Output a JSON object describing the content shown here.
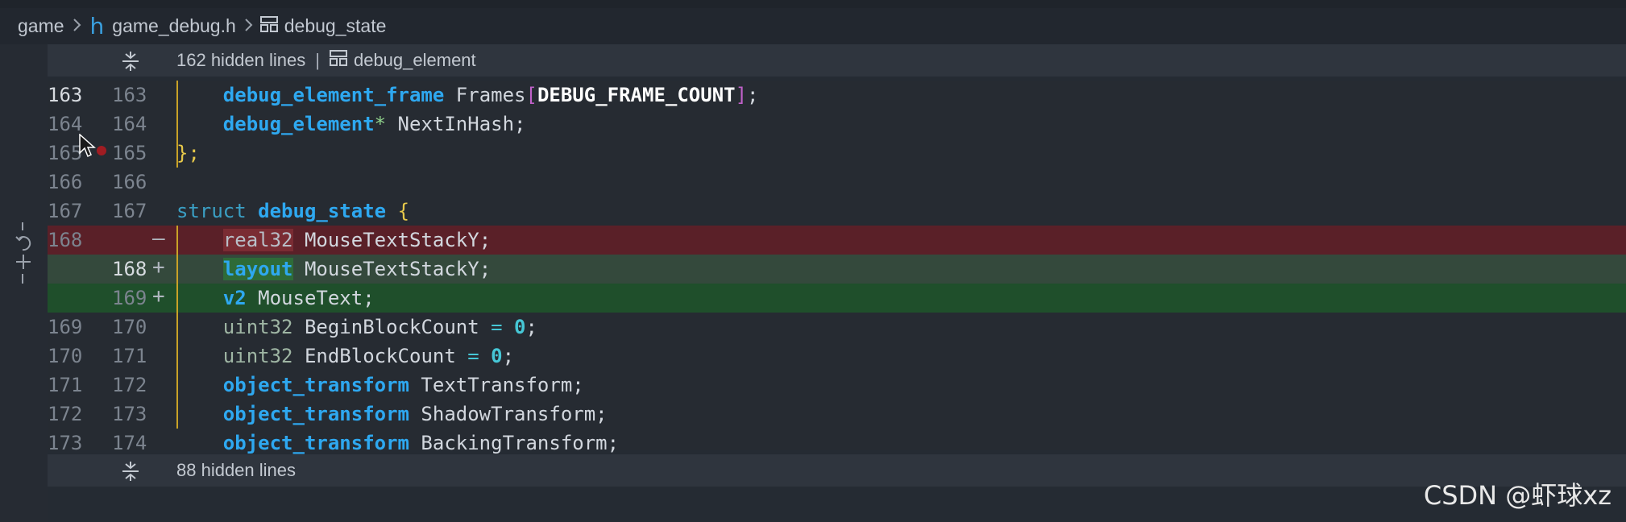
{
  "breadcrumb": {
    "items": [
      "game",
      "game_debug.h",
      "debug_state"
    ]
  },
  "hidden_top": {
    "count_text": "162 hidden lines",
    "separator": "|",
    "symbol": "debug_element"
  },
  "hidden_bottom": {
    "count_text": "88 hidden lines"
  },
  "lines": {
    "l163": {
      "old": "163",
      "new": "163"
    },
    "l164": {
      "old": "164",
      "new": "164"
    },
    "l165": {
      "old": "165",
      "new": "165"
    },
    "l166": {
      "old": "166",
      "new": "166"
    },
    "l167": {
      "old": "167",
      "new": "167"
    },
    "l168d": {
      "old": "168",
      "marker": "—"
    },
    "l168a": {
      "new": "168",
      "marker": "+"
    },
    "l169a": {
      "new": "169",
      "marker": "+"
    },
    "l170": {
      "old": "169",
      "new": "170"
    },
    "l171": {
      "old": "170",
      "new": "171"
    },
    "l172": {
      "old": "171",
      "new": "172"
    },
    "l173": {
      "old": "172",
      "new": "173"
    },
    "l174": {
      "old": "173",
      "new": "174"
    }
  },
  "code": {
    "t_frames_type": "debug_element_frame",
    "t_frames_name": " Frames",
    "t_frames_open": "[",
    "t_frames_const": "DEBUG_FRAME_COUNT",
    "t_frames_close": "]",
    "t_frames_semi": ";",
    "t_next_type": "debug_element",
    "t_next_star": "*",
    "t_next_name": " NextInHash;",
    "t_close": "};",
    "t_struct_kw": "struct",
    "t_struct_name": "debug_state",
    "t_struct_brace": "{",
    "t_del_type": "real32",
    "t_del_name": " MouseTextStackY;",
    "t_add1_type": "layout",
    "t_add1_name": " MouseTextStackY;",
    "t_add2_type": "v2",
    "t_add2_name": " MouseText;",
    "t_begin_type": "uint32",
    "t_begin_name": " BeginBlockCount",
    "t_begin_eq": " = ",
    "t_begin_val": "0",
    "t_begin_semi": ";",
    "t_end_type": "uint32",
    "t_end_name": " EndBlockCount",
    "t_end_eq": " = ",
    "t_end_val": "0",
    "t_end_semi": ";",
    "t_text_type": "object_transform",
    "t_text_name": " TextTransform;",
    "t_shadow_type": "object_transform",
    "t_shadow_name": " ShadowTransform;",
    "t_backing_type": "object_transform",
    "t_backing_name": " BackingTransform;"
  },
  "watermark": "CSDN @虾球xz",
  "colors": {
    "keyword": "#2ea8f0",
    "deleted_bg": "#5a2028",
    "added_bg": "#1f4f2b",
    "modified_bar": "#c9a227"
  },
  "icons": [
    "chevron-right-icon",
    "c-header-file-icon",
    "struct-icon",
    "unfold-icon",
    "revert-icon",
    "breakpoint-icon",
    "mouse-cursor-icon"
  ]
}
